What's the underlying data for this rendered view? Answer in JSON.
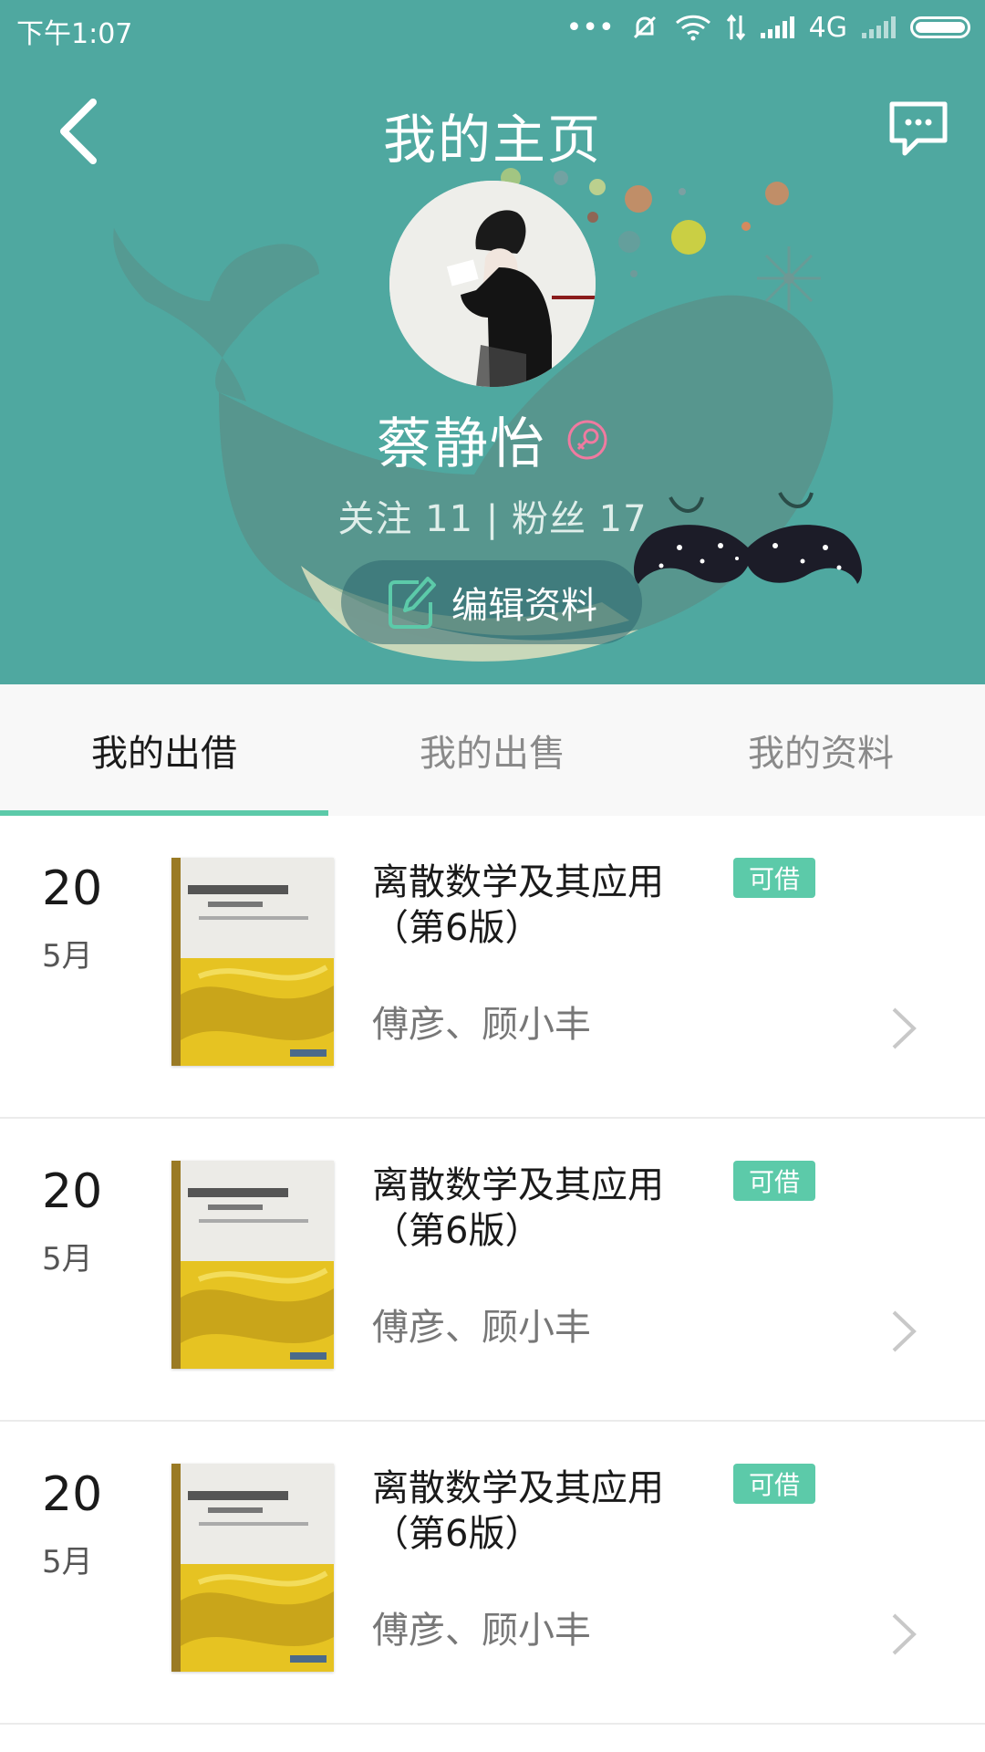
{
  "status_bar": {
    "time": "下午1:07",
    "dots": "•••",
    "network": "4G"
  },
  "header": {
    "title": "我的主页",
    "back_icon": "chevron-left-icon",
    "message_icon": "chat-bubble-icon",
    "background_color": "#4fa8a0"
  },
  "profile": {
    "name": "蔡静怡",
    "gender_icon": "female-icon",
    "follow_label": "关注 11",
    "separator": "|",
    "fans_label": "粉丝 17",
    "edit_label": "编辑资料"
  },
  "tabs": [
    {
      "label": "我的出借",
      "active": true
    },
    {
      "label": "我的出售",
      "active": false
    },
    {
      "label": "我的资料",
      "active": false
    }
  ],
  "books": [
    {
      "day": "20",
      "month": "5月",
      "title": "离散数学及其应用（第6版）",
      "badge": "可借",
      "authors": "傅彦、顾小丰"
    },
    {
      "day": "20",
      "month": "5月",
      "title": "离散数学及其应用（第6版）",
      "badge": "可借",
      "authors": "傅彦、顾小丰"
    },
    {
      "day": "20",
      "month": "5月",
      "title": "离散数学及其应用（第6版）",
      "badge": "可借",
      "authors": "傅彦、顾小丰"
    }
  ],
  "colors": {
    "accent": "#5ccaa9",
    "header": "#4fa8a0"
  }
}
